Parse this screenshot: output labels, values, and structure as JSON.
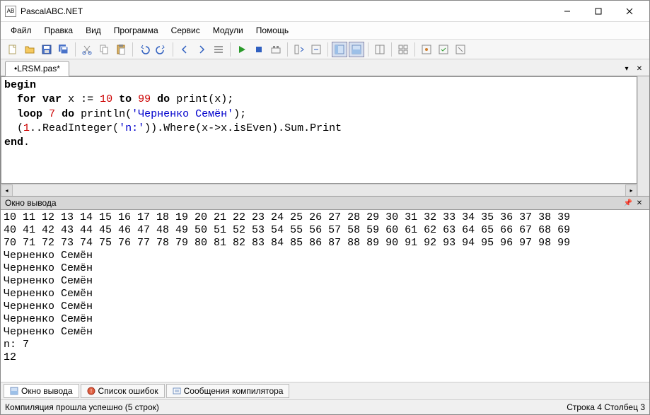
{
  "window": {
    "title": "PascalABC.NET",
    "app_icon_text": "AB"
  },
  "menu": {
    "items": [
      "Файл",
      "Правка",
      "Вид",
      "Программа",
      "Сервис",
      "Модули",
      "Помощь"
    ]
  },
  "tabs": {
    "active": "•LRSM.pas*"
  },
  "code": {
    "lines": [
      {
        "raw": "begin",
        "tokens": [
          [
            "kw",
            "begin"
          ]
        ]
      },
      {
        "raw": "  for var x := 10 to 99 do print(x);",
        "tokens": [
          [
            "t",
            "  "
          ],
          [
            "kw",
            "for"
          ],
          [
            "t",
            " "
          ],
          [
            "kw",
            "var"
          ],
          [
            "t",
            " x := "
          ],
          [
            "num",
            "10"
          ],
          [
            "t",
            " "
          ],
          [
            "kw",
            "to"
          ],
          [
            "t",
            " "
          ],
          [
            "num",
            "99"
          ],
          [
            "t",
            " "
          ],
          [
            "kw",
            "do"
          ],
          [
            "t",
            " print(x);"
          ]
        ]
      },
      {
        "raw": "  loop 7 do println('Черненко Семён');",
        "tokens": [
          [
            "t",
            "  "
          ],
          [
            "kw",
            "loop"
          ],
          [
            "t",
            " "
          ],
          [
            "num",
            "7"
          ],
          [
            "t",
            " "
          ],
          [
            "kw",
            "do"
          ],
          [
            "t",
            " println("
          ],
          [
            "str",
            "'Черненко Семён'"
          ],
          [
            "t",
            ");"
          ]
        ]
      },
      {
        "raw": "  (1..ReadInteger('n:')).Where(x->x.isEven).Sum.Print",
        "tokens": [
          [
            "t",
            "  ("
          ],
          [
            "num",
            "1"
          ],
          [
            "t",
            "..ReadInteger("
          ],
          [
            "str",
            "'n:'"
          ],
          [
            "t",
            ")).Where(x->x.isEven).Sum.Print"
          ]
        ]
      },
      {
        "raw": "end.",
        "tokens": [
          [
            "kw",
            "end"
          ],
          [
            "t",
            "."
          ]
        ]
      }
    ]
  },
  "output_panel": {
    "title": "Окно вывода",
    "lines": [
      "10 11 12 13 14 15 16 17 18 19 20 21 22 23 24 25 26 27 28 29 30 31 32 33 34 35 36 37 38 39",
      "40 41 42 43 44 45 46 47 48 49 50 51 52 53 54 55 56 57 58 59 60 61 62 63 64 65 66 67 68 69",
      "70 71 72 73 74 75 76 77 78 79 80 81 82 83 84 85 86 87 88 89 90 91 92 93 94 95 96 97 98 99",
      "Черненко Семён",
      "Черненко Семён",
      "Черненко Семён",
      "Черненко Семён",
      "Черненко Семён",
      "Черненко Семён",
      "Черненко Семён",
      "n: 7",
      "12"
    ]
  },
  "bottom_tabs": {
    "items": [
      {
        "label": "Окно вывода",
        "active": true
      },
      {
        "label": "Список ошибок",
        "active": false
      },
      {
        "label": "Сообщения компилятора",
        "active": false
      }
    ]
  },
  "status": {
    "left": "Компиляция прошла успешно (5 строк)",
    "right": "Строка 4  Столбец 3"
  },
  "chart_data": {
    "type": "table",
    "note": "No numeric chart; code editor session with output of numbers 10-99, name repeated 7 times, input n:7, result 12"
  }
}
